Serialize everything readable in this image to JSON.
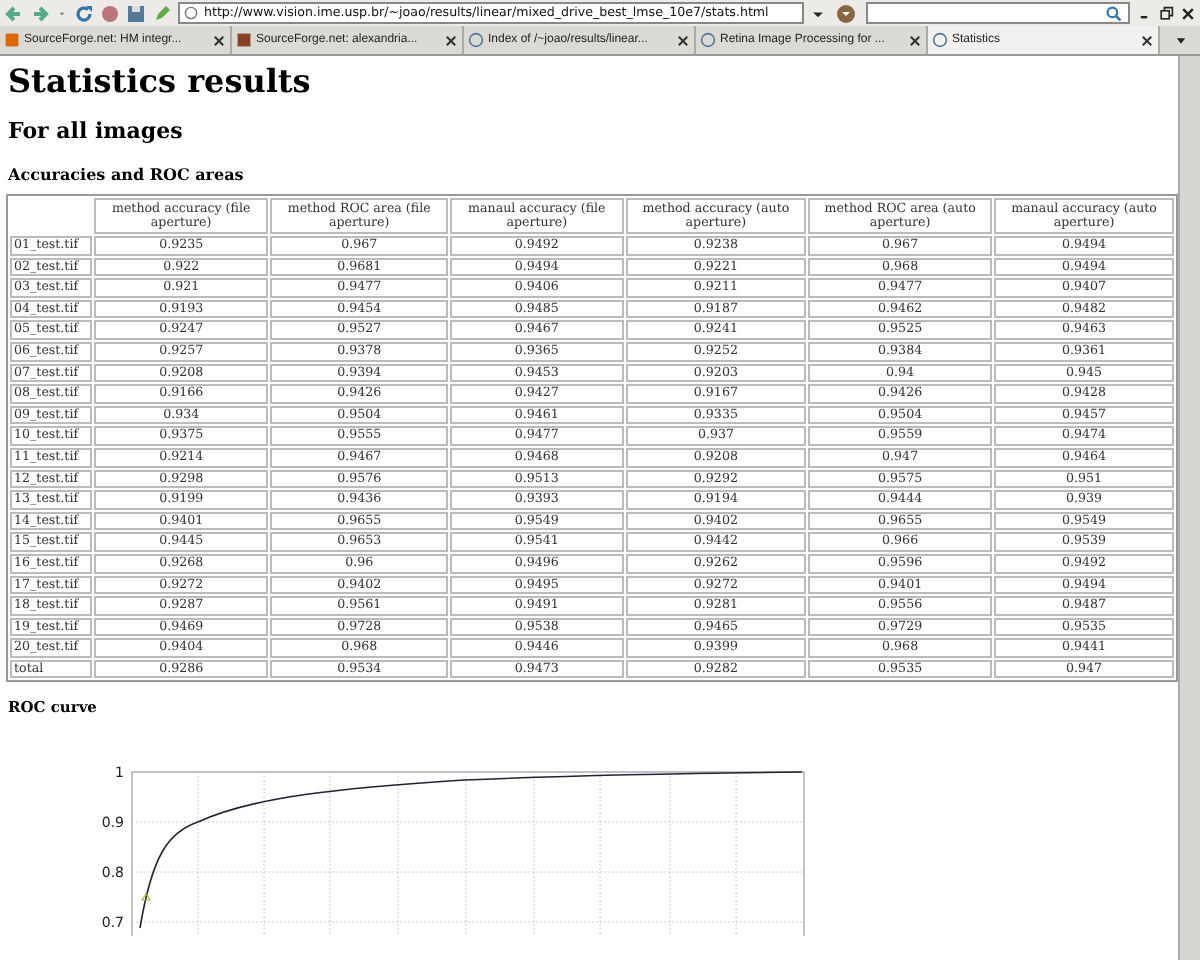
{
  "browser": {
    "address": "http://www.vision.ime.usp.br/~joao/results/linear/mixed_drive_best_lmse_10e7/stats.html",
    "tabs": [
      {
        "label": "SourceForge.net: HM integr...",
        "selected": false
      },
      {
        "label": "SourceForge.net: alexandria...",
        "selected": false
      },
      {
        "label": "Index of /~joao/results/linear...",
        "selected": false
      },
      {
        "label": "Retina Image Processing for ...",
        "selected": false
      },
      {
        "label": "Statistics",
        "selected": true
      }
    ]
  },
  "page": {
    "title": "Statistics results",
    "subtitle": "For all images",
    "section": "Accuracies and ROC areas",
    "table": {
      "columns": [
        "",
        "method accuracy (file aperture)",
        "method ROC area (file aperture)",
        "manaul accuracy (file aperture)",
        "method accuracy (auto aperture)",
        "method ROC area (auto aperture)",
        "manaul accuracy (auto aperture)"
      ],
      "rows": [
        [
          "01_test.tif",
          "0.9235",
          "0.967",
          "0.9492",
          "0.9238",
          "0.967",
          "0.9494"
        ],
        [
          "02_test.tif",
          "0.922",
          "0.9681",
          "0.9494",
          "0.9221",
          "0.968",
          "0.9494"
        ],
        [
          "03_test.tif",
          "0.921",
          "0.9477",
          "0.9406",
          "0.9211",
          "0.9477",
          "0.9407"
        ],
        [
          "04_test.tif",
          "0.9193",
          "0.9454",
          "0.9485",
          "0.9187",
          "0.9462",
          "0.9482"
        ],
        [
          "05_test.tif",
          "0.9247",
          "0.9527",
          "0.9467",
          "0.9241",
          "0.9525",
          "0.9463"
        ],
        [
          "06_test.tif",
          "0.9257",
          "0.9378",
          "0.9365",
          "0.9252",
          "0.9384",
          "0.9361"
        ],
        [
          "07_test.tif",
          "0.9208",
          "0.9394",
          "0.9453",
          "0.9203",
          "0.94",
          "0.945"
        ],
        [
          "08_test.tif",
          "0.9166",
          "0.9426",
          "0.9427",
          "0.9167",
          "0.9426",
          "0.9428"
        ],
        [
          "09_test.tif",
          "0.934",
          "0.9504",
          "0.9461",
          "0.9335",
          "0.9504",
          "0.9457"
        ],
        [
          "10_test.tif",
          "0.9375",
          "0.9555",
          "0.9477",
          "0.937",
          "0.9559",
          "0.9474"
        ],
        [
          "11_test.tif",
          "0.9214",
          "0.9467",
          "0.9468",
          "0.9208",
          "0.947",
          "0.9464"
        ],
        [
          "12_test.tif",
          "0.9298",
          "0.9576",
          "0.9513",
          "0.9292",
          "0.9575",
          "0.951"
        ],
        [
          "13_test.tif",
          "0.9199",
          "0.9436",
          "0.9393",
          "0.9194",
          "0.9444",
          "0.939"
        ],
        [
          "14_test.tif",
          "0.9401",
          "0.9655",
          "0.9549",
          "0.9402",
          "0.9655",
          "0.9549"
        ],
        [
          "15_test.tif",
          "0.9445",
          "0.9653",
          "0.9541",
          "0.9442",
          "0.966",
          "0.9539"
        ],
        [
          "16_test.tif",
          "0.9268",
          "0.96",
          "0.9496",
          "0.9262",
          "0.9596",
          "0.9492"
        ],
        [
          "17_test.tif",
          "0.9272",
          "0.9402",
          "0.9495",
          "0.9272",
          "0.9401",
          "0.9494"
        ],
        [
          "18_test.tif",
          "0.9287",
          "0.9561",
          "0.9491",
          "0.9281",
          "0.9556",
          "0.9487"
        ],
        [
          "19_test.tif",
          "0.9469",
          "0.9728",
          "0.9538",
          "0.9465",
          "0.9729",
          "0.9535"
        ],
        [
          "20_test.tif",
          "0.9404",
          "0.968",
          "0.9446",
          "0.9399",
          "0.968",
          "0.9441"
        ],
        [
          "total",
          "0.9286",
          "0.9534",
          "0.9473",
          "0.9282",
          "0.9535",
          "0.947"
        ]
      ]
    },
    "roc": {
      "heading": "ROC curve",
      "y_tick_labels": [
        "1",
        "0.9",
        "0.8",
        "0.7"
      ]
    }
  }
}
